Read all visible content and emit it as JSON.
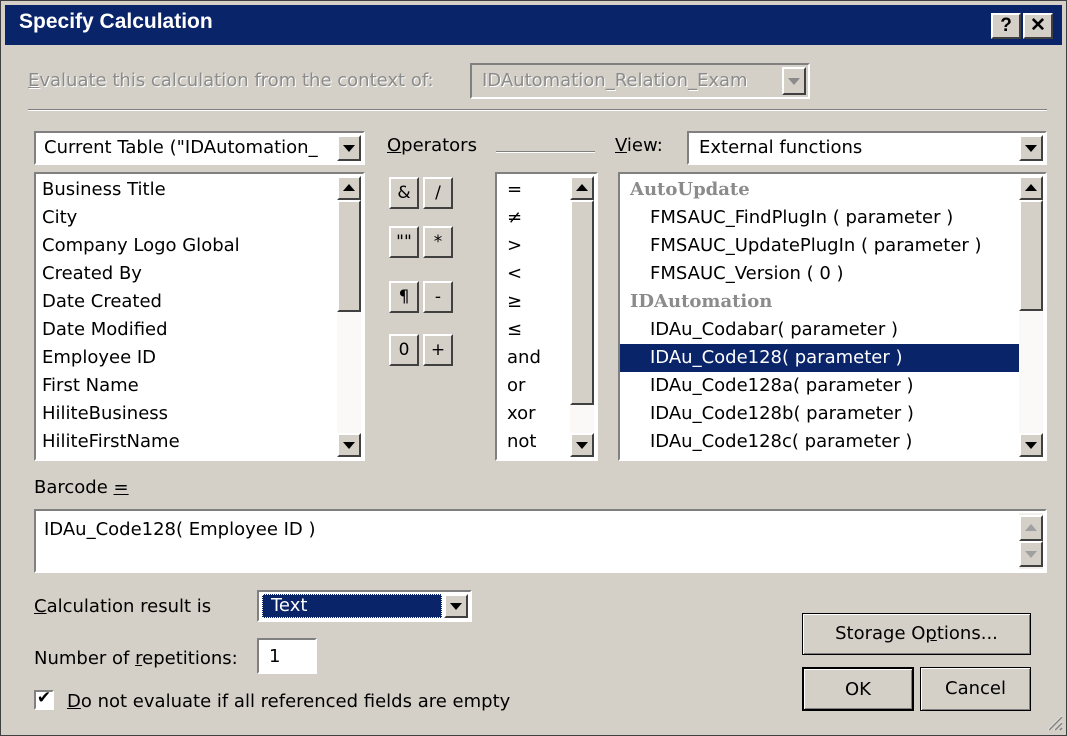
{
  "window": {
    "title": "Specify Calculation",
    "help_button": "?",
    "close_button": "✕"
  },
  "context": {
    "label_prefix": "E",
    "label_rest": "valuate this calculation from the context of:",
    "value": "IDAutomation_Relation_Exam"
  },
  "table_selector": {
    "value": "Current Table (\"IDAutomation_"
  },
  "fields": [
    "Business Title",
    "City",
    "Company Logo Global",
    "Created By",
    "Date Created",
    "Date Modified",
    "Employee ID",
    "First Name",
    "HiliteBusiness",
    "HiliteFirstName"
  ],
  "operators": {
    "label_prefix": "O",
    "label_rest": "perators",
    "buttons": [
      "&",
      "/",
      "\"\"",
      "*",
      "¶",
      "-",
      "0",
      "+"
    ],
    "list": [
      "=",
      "≠",
      ">",
      "<",
      "≥",
      "≤",
      "and",
      "or",
      "xor",
      "not"
    ]
  },
  "view": {
    "label_prefix": "V",
    "label_rest": "iew:",
    "value": "External functions"
  },
  "functions": [
    {
      "text": "AutoUpdate",
      "header": true
    },
    {
      "text": "FMSAUC_FindPlugIn ( parameter )",
      "header": false
    },
    {
      "text": "FMSAUC_UpdatePlugIn ( parameter )",
      "header": false
    },
    {
      "text": "FMSAUC_Version ( 0 )",
      "header": false
    },
    {
      "text": "IDAutomation",
      "header": true
    },
    {
      "text": "IDAu_Codabar( parameter )",
      "header": false
    },
    {
      "text": "IDAu_Code128( parameter )",
      "header": false,
      "selected": true
    },
    {
      "text": "IDAu_Code128a( parameter )",
      "header": false
    },
    {
      "text": "IDAu_Code128b( parameter )",
      "header": false
    },
    {
      "text": "IDAu_Code128c( parameter )",
      "header": false
    }
  ],
  "formula": {
    "field_label": "Barcode",
    "eq": "=",
    "text": "IDAu_Code128( Employee ID )"
  },
  "result": {
    "label_prefix": "C",
    "label_rest": "alculation result is",
    "value": "Text"
  },
  "repetitions": {
    "label_a": "Number of ",
    "label_ul": "r",
    "label_b": "epetitions:",
    "value": "1"
  },
  "checkbox": {
    "checked": true,
    "mark": "✔",
    "label_prefix": "D",
    "label_rest": "o not evaluate if all referenced fields are empty"
  },
  "buttons": {
    "storage_a": "Storage O",
    "storage_ul": "p",
    "storage_b": "tions...",
    "ok": "OK",
    "cancel": "Cancel"
  },
  "colors": {
    "titlebar": "#0a246a",
    "selection": "#0a246a",
    "face": "#d4d0c8"
  }
}
